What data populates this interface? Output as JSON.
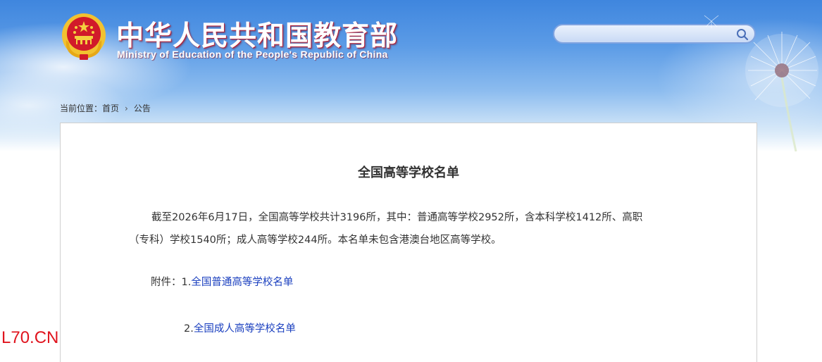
{
  "header": {
    "title_cn": "中华人民共和国教育部",
    "title_en": "Ministry of Education of the People's Republic of China",
    "logo_icon": "national-emblem-icon"
  },
  "search": {
    "value": "",
    "icon": "search-icon"
  },
  "breadcrumb": {
    "label": "当前位置：",
    "home": "首页",
    "current": "公告",
    "separator_icon": "chevron-right-icon"
  },
  "article": {
    "title": "全国高等学校名单",
    "para_line1": "截至2026年6月17日，全国高等学校共计3196所，其中：普通高等学校2952所，含本科学校1412所、高职",
    "para_line2": "（专科）学校1540所；成人高等学校244所。本名单未包含港澳台地区高等学校。",
    "attach_label": "附件：",
    "attachments": [
      {
        "num": "1.",
        "title": "全国普通高等学校名单"
      },
      {
        "num": "2.",
        "title": "全国成人高等学校名单"
      }
    ]
  },
  "watermark": "L70.CN",
  "colors": {
    "header_blue": "#3f86de",
    "link": "#1a3fbf",
    "watermark": "#e0141e",
    "emblem_red": "#d11a2a",
    "emblem_gold": "#f4c430"
  }
}
